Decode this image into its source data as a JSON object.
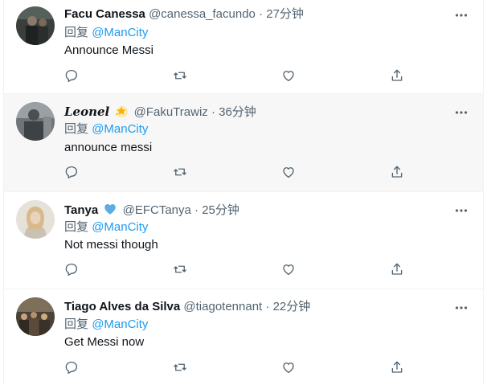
{
  "reply_prefix": "回复",
  "tweets": [
    {
      "name": "Facu Canessa",
      "handle": "@canessa_facundo",
      "separator": "·",
      "time": "27分钟",
      "mention": "@ManCity",
      "text": "Announce Messi",
      "avatar_icon": "avatar-photo-dark"
    },
    {
      "name": "Leonel",
      "name_badge_icon": "sparkle-star-icon",
      "handle": "@FakuTrawiz",
      "separator": "·",
      "time": "36分钟",
      "mention": "@ManCity",
      "text": "announce messi",
      "avatar_icon": "avatar-photo-grey"
    },
    {
      "name": "Tanya",
      "name_badge_icon": "blue-heart-icon",
      "handle": "@EFCTanya",
      "separator": "·",
      "time": "25分钟",
      "mention": "@ManCity",
      "text": "Not messi though",
      "avatar_icon": "avatar-photo-light"
    },
    {
      "name": "Tiago Alves da Silva",
      "handle": "@tiagotennant",
      "separator": "·",
      "time": "22分钟",
      "mention": "@ManCity",
      "text": "Get Messi now",
      "avatar_icon": "avatar-photo-crowd"
    }
  ],
  "action_icons": [
    "reply-icon",
    "retweet-icon",
    "like-icon",
    "share-icon"
  ],
  "colors": {
    "link": "#1d9bf0",
    "secondary_text": "#536471",
    "primary_text": "#0f1419",
    "hover_background": "#f7f7f7",
    "heart_badge": "#5dade2",
    "star_badge": "#f5b301"
  }
}
